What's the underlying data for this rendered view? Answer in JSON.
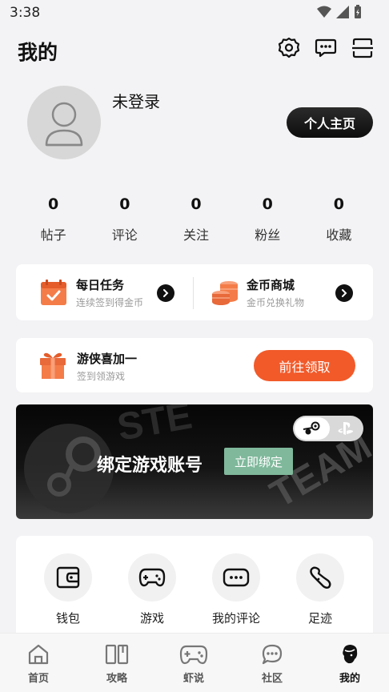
{
  "status": {
    "time": "3:38"
  },
  "header": {
    "title": "我的"
  },
  "profile": {
    "username": "未登录",
    "home_button": "个人主页"
  },
  "stats": [
    {
      "value": "0",
      "label": "帖子"
    },
    {
      "value": "0",
      "label": "评论"
    },
    {
      "value": "0",
      "label": "关注"
    },
    {
      "value": "0",
      "label": "粉丝"
    },
    {
      "value": "0",
      "label": "收藏"
    }
  ],
  "tasks": {
    "daily": {
      "title": "每日任务",
      "subtitle": "连续签到得金币"
    },
    "mall": {
      "title": "金币商城",
      "subtitle": "金币兑换礼物"
    }
  },
  "gift": {
    "title": "游侠喜加一",
    "subtitle": "签到领游戏",
    "button": "前往领取"
  },
  "banner": {
    "text": "绑定游戏账号",
    "button": "立即绑定",
    "watermark": "STEAM"
  },
  "tools": [
    {
      "label": "钱包"
    },
    {
      "label": "游戏"
    },
    {
      "label": "我的评论"
    },
    {
      "label": "足迹"
    }
  ],
  "nav": [
    {
      "label": "首页"
    },
    {
      "label": "攻略"
    },
    {
      "label": "虾说"
    },
    {
      "label": "社区"
    },
    {
      "label": "我的"
    }
  ],
  "colors": {
    "accent": "#f25a2a",
    "bind_button": "#7fb89b",
    "task_orange": "#f47c48"
  }
}
